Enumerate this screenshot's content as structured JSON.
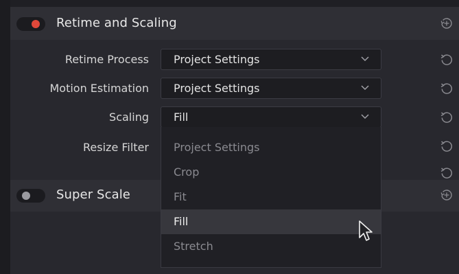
{
  "colors": {
    "toggle_on": "#e0483a",
    "toggle_off": "#9a9aa0",
    "dim_text": "#8a8a90",
    "bright_text": "#e4e4e4"
  },
  "sections": {
    "retime": {
      "title": "Retime and Scaling",
      "enabled": true,
      "reset_icon": "reset-history-icon"
    },
    "superscale": {
      "title": "Super Scale",
      "enabled": false,
      "reset_icon": "reset-history-icon"
    }
  },
  "fields": [
    {
      "label": "Retime Process",
      "value": "Project Settings"
    },
    {
      "label": "Motion Estimation",
      "value": "Project Settings"
    },
    {
      "label": "Scaling",
      "value": "Fill"
    },
    {
      "label": "Resize Filter",
      "value": ""
    }
  ],
  "dropdown": {
    "options": [
      "Project Settings",
      "Crop",
      "Fit",
      "Fill",
      "Stretch"
    ],
    "selected": "Fill"
  },
  "icons": {
    "chevron": "chevron-down-icon",
    "reset": "reset-arrow-icon",
    "cursor": "mouse-pointer-icon"
  }
}
